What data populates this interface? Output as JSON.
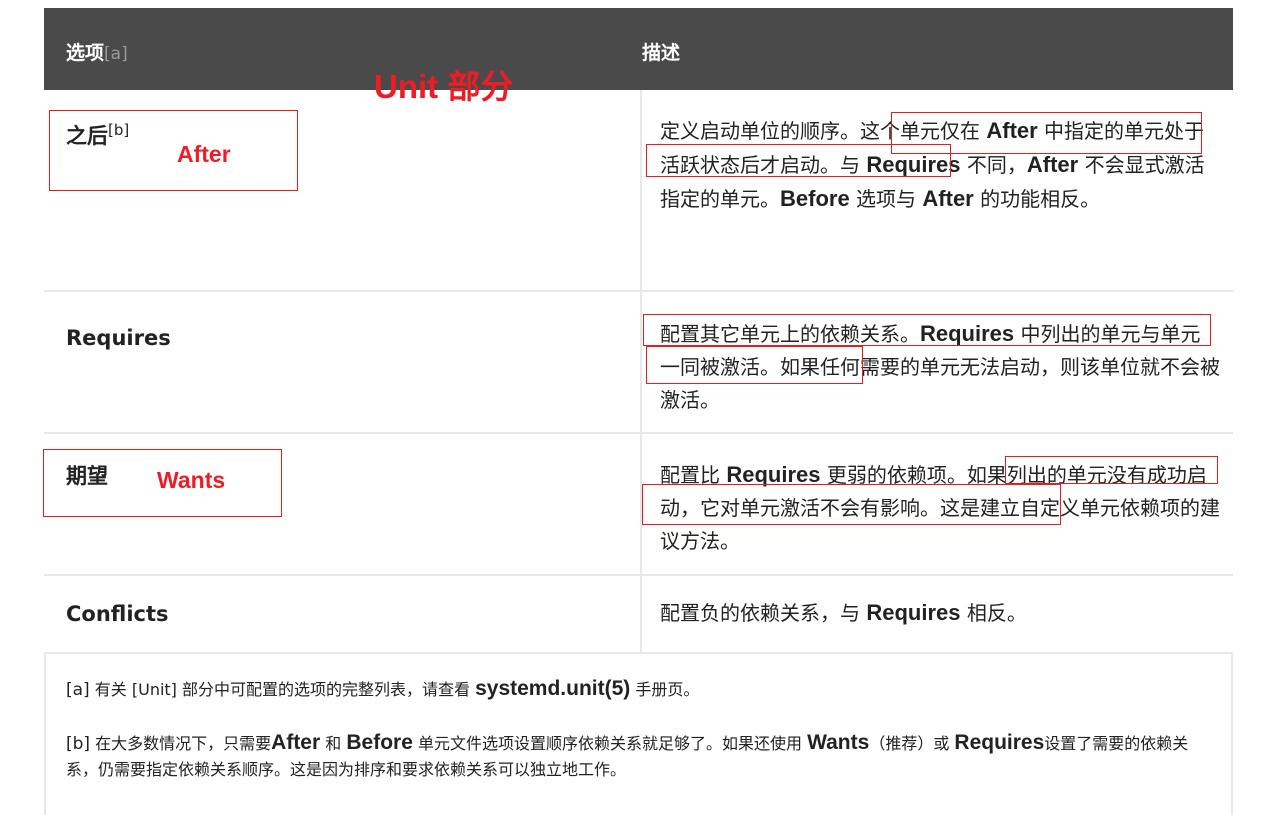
{
  "header": {
    "option_label": "选项",
    "option_note": "[a]",
    "desc_label": "描述"
  },
  "annotations": {
    "section_title": "Unit 部分",
    "after_label": "After",
    "wants_label": "Wants",
    "color": "#ee1c24"
  },
  "rows": [
    {
      "option": "之后",
      "option_note": "[b]",
      "desc": [
        {
          "t": "定义启动单位的顺序。这个单元仅在 "
        },
        {
          "t": "After",
          "b": true
        },
        {
          "t": " 中指定的单元处于活跃状态后才启动。与 "
        },
        {
          "t": "Requires",
          "b": true
        },
        {
          "t": " 不同，"
        },
        {
          "t": "After",
          "b": true
        },
        {
          "t": " 不会显式激活指定的单元。"
        },
        {
          "t": "Before",
          "b": true
        },
        {
          "t": " 选项与 "
        },
        {
          "t": "After",
          "b": true
        },
        {
          "t": " 的功能相反。"
        }
      ]
    },
    {
      "option": "Requires",
      "desc": [
        {
          "t": "配置其它单元上的依赖关系。"
        },
        {
          "t": "Requires",
          "b": true
        },
        {
          "t": " 中列出的单元与单元一同被激活。如果任何需要的单元无法启动，则该单位就不会被激活。"
        }
      ]
    },
    {
      "option": "期望",
      "desc": [
        {
          "t": "配置比 "
        },
        {
          "t": "Requires",
          "b": true
        },
        {
          "t": " 更弱的依赖项。如果列出的单元没有成功启动，它对单元激活不会有影响。这是建立自定义单元依赖项的建议方法。"
        }
      ]
    },
    {
      "option": "Conflicts",
      "desc": [
        {
          "t": "配置负的依赖关系，与 "
        },
        {
          "t": "Requires",
          "b": true
        },
        {
          "t": " 相反。"
        }
      ]
    }
  ],
  "footnotes": [
    {
      "mark": "[a]",
      "parts": [
        {
          "t": " 有关 [Unit] 部分中可配置的选项的完整列表，请查看 "
        },
        {
          "t": "systemd.unit(5)",
          "b": true
        },
        {
          "t": " 手册页。"
        }
      ]
    },
    {
      "mark": "[b]",
      "parts": [
        {
          "t": " 在大多数情况下，只需要"
        },
        {
          "t": "After",
          "b": true
        },
        {
          "t": " 和 "
        },
        {
          "t": "Before",
          "b": true
        },
        {
          "t": " 单元文件选项设置顺序依赖关系就足够了。如果还使用 "
        },
        {
          "t": "Wants",
          "b": true
        },
        {
          "t": "（推荐）或 "
        },
        {
          "t": "Requires",
          "b": true
        },
        {
          "t": "设置了需要的依赖关系，仍需要指定依赖关系顺序。这是因为排序和要求依赖关系可以独立地工作。"
        }
      ]
    }
  ]
}
